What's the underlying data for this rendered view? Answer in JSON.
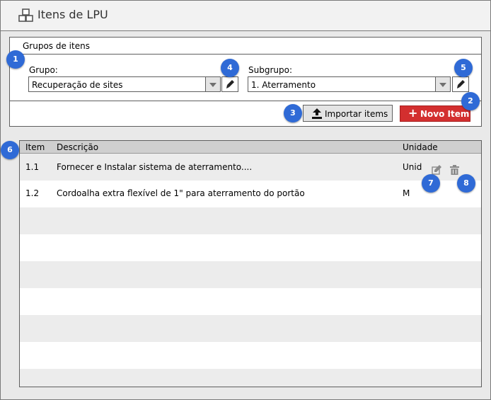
{
  "window": {
    "title": "Itens de LPU"
  },
  "groups": {
    "title": "Grupos de itens",
    "grupo": {
      "label": "Grupo:",
      "value": "Recuperação de sites"
    },
    "subgrupo": {
      "label": "Subgrupo:",
      "value": "1. Aterramento"
    },
    "import_label": "Importar items",
    "new_plus": "+",
    "new_label": "Novo Item"
  },
  "table": {
    "headers": {
      "item": "Item",
      "descricao": "Descrição",
      "unidade": "Unidade"
    },
    "rows": [
      {
        "item": "1.1",
        "descricao": "Fornecer e Instalar sistema de aterramento....",
        "unidade": "Unid"
      },
      {
        "item": "1.2",
        "descricao": "Cordoalha extra flexível de 1\" para aterramento do portão",
        "unidade": "M"
      }
    ]
  },
  "badges": [
    "1",
    "2",
    "3",
    "4",
    "5",
    "6",
    "7",
    "8"
  ],
  "colors": {
    "badge": "#2f6ad6",
    "new_button": "#d32f2f",
    "header": "#cfcfcf",
    "row_alt": "#ececec"
  },
  "icons": {
    "title": "boxes-icon",
    "edit": "pencil-icon",
    "import": "upload-icon",
    "new": "plus-icon",
    "row_edit": "edit-icon",
    "row_delete": "trash-icon"
  }
}
